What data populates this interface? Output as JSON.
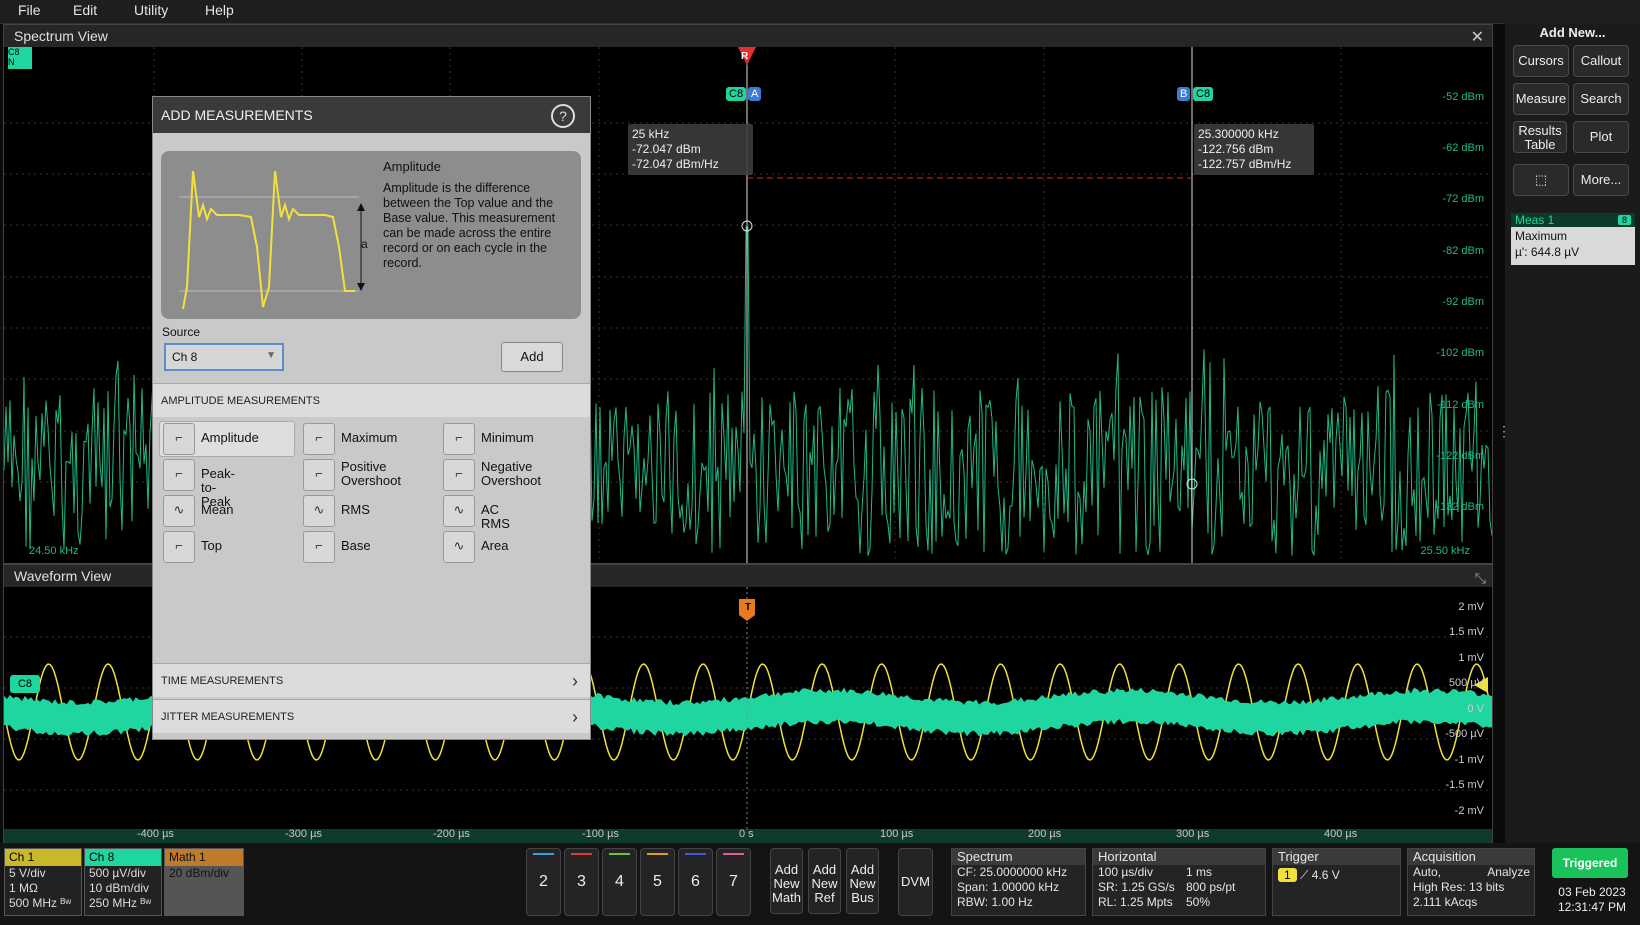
{
  "menubar": {
    "items": [
      "File",
      "Edit",
      "Utility",
      "Help"
    ]
  },
  "spectrum": {
    "title": "Spectrum View",
    "ch_tag": "C8\nN",
    "y_labels": [
      "-52 dBm",
      "-62 dBm",
      "-72 dBm",
      "-82 dBm",
      "-92 dBm",
      "-102 dBm",
      "-112 dBm",
      "-122 dBm",
      "-132 dBm"
    ],
    "x_start": "24.50 kHz",
    "x_end": "25.50 kHz",
    "ref_marker": "R",
    "cursor_a": {
      "ch": "C8",
      "id": "A",
      "readout": [
        "25 kHz",
        "-72.047 dBm",
        "-72.047 dBm/Hz"
      ]
    },
    "cursor_b": {
      "id": "B",
      "ch": "C8",
      "readout": [
        "25.300000 kHz",
        "-122.756 dBm",
        "-122.757 dBm/Hz"
      ]
    }
  },
  "waveform": {
    "title": "Waveform View",
    "ch_tag": "C8",
    "trigger_marker": "T",
    "y_labels": [
      "2 mV",
      "1.5 mV",
      "1 mV",
      "500 µV",
      "0 V",
      "-500 µV",
      "-1 mV",
      "-1.5 mV",
      "-2 mV"
    ],
    "x_labels": [
      "-400 µs",
      "-300 µs",
      "-200 µs",
      "-100 µs",
      "0 s",
      "100 µs",
      "200 µs",
      "300 µs",
      "400 µs"
    ]
  },
  "dialog": {
    "title": "ADD MEASUREMENTS",
    "help": "?",
    "preview_title": "Amplitude",
    "preview_text": "Amplitude is the difference between the Top value and the Base value. This measurement can be made across the entire record or on each cycle in the record.",
    "preview_mark": "a",
    "source_label": "Source",
    "source_value": "Ch 8",
    "add_label": "Add",
    "amp_section": "AMPLITUDE MEASUREMENTS",
    "measurements": [
      [
        "Amplitude",
        "Maximum",
        "Minimum"
      ],
      [
        "Peak-to-Peak",
        "Positive Overshoot",
        "Negative Overshoot"
      ],
      [
        "Mean",
        "RMS",
        "AC RMS"
      ],
      [
        "Top",
        "Base",
        "Area"
      ]
    ],
    "time_section": "TIME MEASUREMENTS",
    "jitter_section": "JITTER MEASUREMENTS"
  },
  "rightbar": {
    "title": "Add New...",
    "buttons": [
      "Cursors",
      "Callout",
      "Measure",
      "Search",
      "Results Table",
      "Plot",
      "More..."
    ],
    "meas": {
      "name": "Meas 1",
      "badge": "8",
      "line1": "Maximum",
      "line2": "µ': 644.8 µV"
    }
  },
  "bottom": {
    "ch1": {
      "label": "Ch 1",
      "lines": [
        "5 V/div",
        "1 MΩ",
        "500 MHz ᴮʷ"
      ]
    },
    "ch8": {
      "label": "Ch 8",
      "lines": [
        "500 µV/div",
        "10 dBm/div",
        "250 MHz ᴮʷ"
      ]
    },
    "math1": {
      "label": "Math 1",
      "lines": [
        "20 dBm/div"
      ]
    },
    "channels": [
      "2",
      "3",
      "4",
      "5",
      "6",
      "7"
    ],
    "add_math": "Add New Math",
    "add_ref": "Add New Ref",
    "add_bus": "Add New Bus",
    "dvm": "DVM",
    "spectrum": {
      "title": "Spectrum",
      "lines": [
        "CF: 25.0000000 kHz",
        "Span: 1.00000 kHz",
        "RBW: 1.00 Hz"
      ]
    },
    "horizontal": {
      "title": "Horizontal",
      "col1": [
        "100 µs/div",
        "SR: 1.25 GS/s",
        "RL: 1.25 Mpts"
      ],
      "col2": [
        "1 ms",
        "800 ps/pt",
        "50%"
      ]
    },
    "trigger": {
      "title": "Trigger",
      "src": "1",
      "level": "4.6 V"
    },
    "acquisition": {
      "title": "Acquisition",
      "lines": [
        "Auto,",
        "High Res: 13 bits",
        "2.111 kAcqs"
      ],
      "analyze": "Analyze"
    },
    "triggered": "Triggered",
    "date": "03 Feb 2023",
    "time": "12:31:47 PM"
  },
  "colors": {
    "ch8": "#1fd6a0",
    "ch1": "#f2e13c",
    "math": "#e08a2a",
    "triggered": "#19c25a"
  }
}
